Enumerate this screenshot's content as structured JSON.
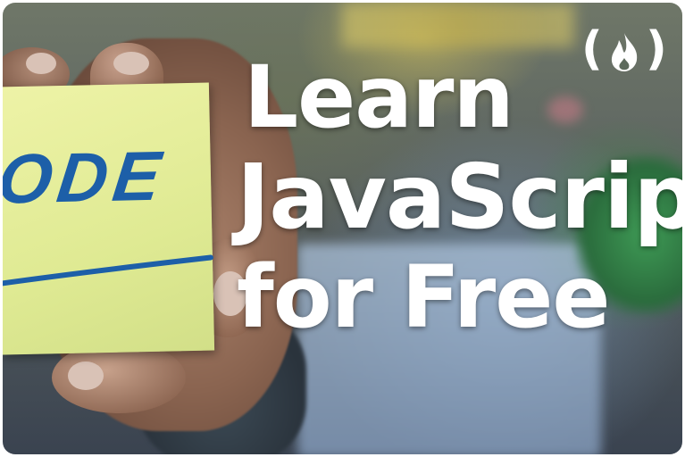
{
  "headline": {
    "line1": "Learn",
    "line2": "JavaScript",
    "line3": "for Free"
  },
  "sticky_note": {
    "text": "ODE"
  },
  "logo": {
    "left_paren": "(",
    "right_paren": ")",
    "icon": "flame-icon",
    "color": "#ffffff"
  },
  "colors": {
    "note": "#e4ee9c",
    "note_ink": "#1d5fa8",
    "text": "#ffffff"
  }
}
